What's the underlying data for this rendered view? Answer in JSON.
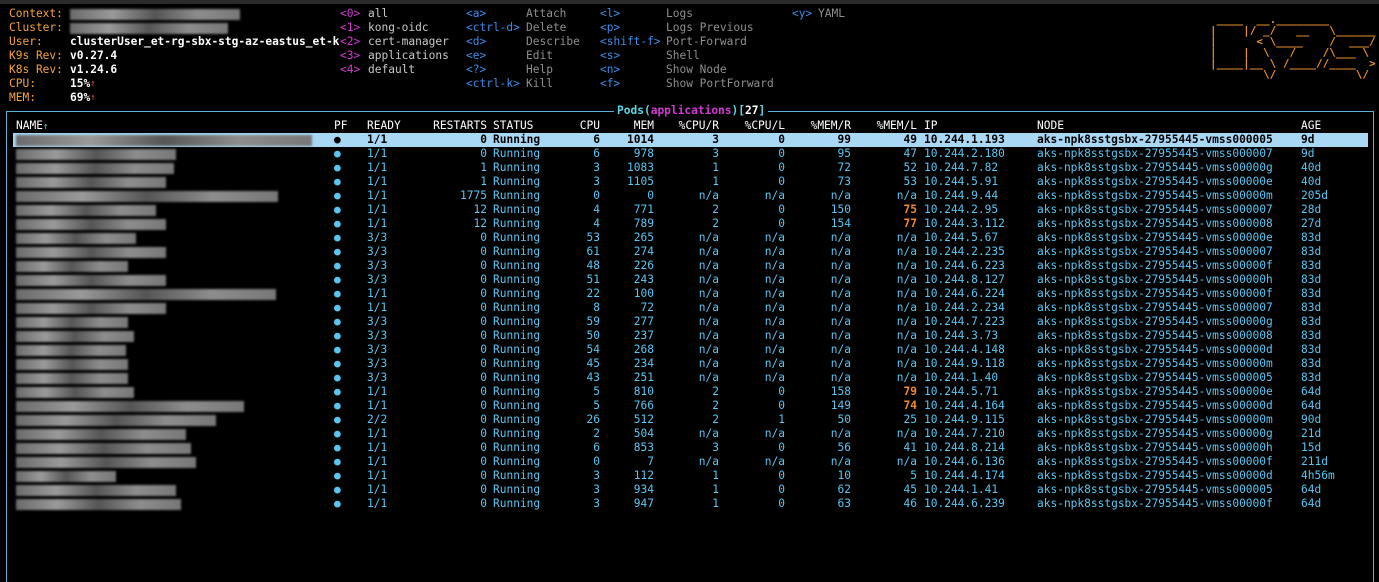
{
  "info": [
    {
      "label": "Context:",
      "value": "",
      "redacted": true
    },
    {
      "label": "Cluster:",
      "value": "",
      "redacted": true
    },
    {
      "label": "User:",
      "value": "clusterUser_et-rg-sbx-stg-az-eastus_et-k"
    },
    {
      "label": "K9s Rev:",
      "value": "v0.27.4"
    },
    {
      "label": "K8s Rev:",
      "value": "v1.24.6"
    },
    {
      "label": "CPU:",
      "value": "15%",
      "arrow": "↑"
    },
    {
      "label": "MEM:",
      "value": "69%",
      "arrow": "↑"
    }
  ],
  "namespaces": [
    {
      "key": "<0>",
      "name": "all"
    },
    {
      "key": "<1>",
      "name": "kong-oidc"
    },
    {
      "key": "<2>",
      "name": "cert-manager"
    },
    {
      "key": "<3>",
      "name": "applications"
    },
    {
      "key": "<4>",
      "name": "default"
    }
  ],
  "hotkeys_col1": [
    {
      "key": "<a>",
      "label": "Attach"
    },
    {
      "key": "<ctrl-d>",
      "label": "Delete"
    },
    {
      "key": "<d>",
      "label": "Describe"
    },
    {
      "key": "<e>",
      "label": "Edit"
    },
    {
      "key": "<?>",
      "label": "Help"
    },
    {
      "key": "<ctrl-k>",
      "label": "Kill"
    }
  ],
  "hotkeys_col2": [
    {
      "key": "<l>",
      "label": "Logs"
    },
    {
      "key": "<p>",
      "label": "Logs Previous"
    },
    {
      "key": "<shift-f>",
      "label": "Port-Forward"
    },
    {
      "key": "<s>",
      "label": "Shell"
    },
    {
      "key": "<n>",
      "label": "Show Node"
    },
    {
      "key": "<f>",
      "label": "Show PortForward"
    }
  ],
  "hotkeys_col3": [
    {
      "key": "<y>",
      "label": "YAML"
    }
  ],
  "logo": [
    " ____  __.________       ",
    "|    |/ _/   __   \\______",
    "|      < \\____    /  ___/",
    "|    |  \\   /    /\\___ \\ ",
    "|____|__ \\ /____//____  >",
    "        \\/            \\/ "
  ],
  "table_title": {
    "resource": "Pods",
    "namespace": "applications",
    "count": "27"
  },
  "columns": {
    "name": "NAME",
    "sort_arrow": "↑",
    "pf": "PF",
    "ready": "READY",
    "restarts": "RESTARTS",
    "status": "STATUS",
    "cpu": "CPU",
    "mem": "MEM",
    "cpu_r": "%CPU/R",
    "cpu_l": "%CPU/L",
    "mem_r": "%MEM/R",
    "mem_l": "%MEM/L",
    "ip": "IP",
    "node": "NODE",
    "age": "AGE"
  },
  "rows": [
    {
      "pf": "●",
      "ready": "1/1",
      "restarts": "0",
      "status": "Running",
      "cpu": "6",
      "mem": "1014",
      "cpu_r": "3",
      "cpu_l": "0",
      "mem_r": "99",
      "mem_l": "49",
      "ip": "10.244.1.193",
      "node": "aks-npk8sstgsbx-27955445-vmss000005",
      "age": "9d"
    },
    {
      "pf": "●",
      "ready": "1/1",
      "restarts": "0",
      "status": "Running",
      "cpu": "6",
      "mem": "978",
      "cpu_r": "3",
      "cpu_l": "0",
      "mem_r": "95",
      "mem_l": "47",
      "ip": "10.244.2.180",
      "node": "aks-npk8sstgsbx-27955445-vmss000007",
      "age": "9d"
    },
    {
      "pf": "●",
      "ready": "1/1",
      "restarts": "1",
      "status": "Running",
      "cpu": "3",
      "mem": "1083",
      "cpu_r": "1",
      "cpu_l": "0",
      "mem_r": "72",
      "mem_l": "52",
      "ip": "10.244.7.82",
      "node": "aks-npk8sstgsbx-27955445-vmss00000g",
      "age": "40d"
    },
    {
      "pf": "●",
      "ready": "1/1",
      "restarts": "1",
      "status": "Running",
      "cpu": "3",
      "mem": "1105",
      "cpu_r": "1",
      "cpu_l": "0",
      "mem_r": "73",
      "mem_l": "53",
      "ip": "10.244.5.91",
      "node": "aks-npk8sstgsbx-27955445-vmss00000e",
      "age": "40d"
    },
    {
      "pf": "●",
      "ready": "1/1",
      "restarts": "1775",
      "status": "Running",
      "cpu": "0",
      "mem": "0",
      "cpu_r": "n/a",
      "cpu_l": "n/a",
      "mem_r": "n/a",
      "mem_l": "n/a",
      "ip": "10.244.9.44",
      "node": "aks-npk8sstgsbx-27955445-vmss00000m",
      "age": "205d"
    },
    {
      "pf": "●",
      "ready": "1/1",
      "restarts": "12",
      "status": "Running",
      "cpu": "4",
      "mem": "771",
      "cpu_r": "2",
      "cpu_l": "0",
      "mem_r": "150",
      "mem_l": "75",
      "warn": true,
      "ip": "10.244.2.95",
      "node": "aks-npk8sstgsbx-27955445-vmss000007",
      "age": "28d"
    },
    {
      "pf": "●",
      "ready": "1/1",
      "restarts": "12",
      "status": "Running",
      "cpu": "4",
      "mem": "789",
      "cpu_r": "2",
      "cpu_l": "0",
      "mem_r": "154",
      "mem_l": "77",
      "warn": true,
      "ip": "10.244.3.112",
      "node": "aks-npk8sstgsbx-27955445-vmss000008",
      "age": "27d"
    },
    {
      "pf": "●",
      "ready": "3/3",
      "restarts": "0",
      "status": "Running",
      "cpu": "53",
      "mem": "265",
      "cpu_r": "n/a",
      "cpu_l": "n/a",
      "mem_r": "n/a",
      "mem_l": "n/a",
      "ip": "10.244.5.67",
      "node": "aks-npk8sstgsbx-27955445-vmss00000e",
      "age": "83d"
    },
    {
      "pf": "●",
      "ready": "3/3",
      "restarts": "0",
      "status": "Running",
      "cpu": "61",
      "mem": "274",
      "cpu_r": "n/a",
      "cpu_l": "n/a",
      "mem_r": "n/a",
      "mem_l": "n/a",
      "ip": "10.244.2.235",
      "node": "aks-npk8sstgsbx-27955445-vmss000007",
      "age": "83d"
    },
    {
      "pf": "●",
      "ready": "3/3",
      "restarts": "0",
      "status": "Running",
      "cpu": "48",
      "mem": "226",
      "cpu_r": "n/a",
      "cpu_l": "n/a",
      "mem_r": "n/a",
      "mem_l": "n/a",
      "ip": "10.244.6.223",
      "node": "aks-npk8sstgsbx-27955445-vmss00000f",
      "age": "83d"
    },
    {
      "pf": "●",
      "ready": "3/3",
      "restarts": "0",
      "status": "Running",
      "cpu": "51",
      "mem": "243",
      "cpu_r": "n/a",
      "cpu_l": "n/a",
      "mem_r": "n/a",
      "mem_l": "n/a",
      "ip": "10.244.8.127",
      "node": "aks-npk8sstgsbx-27955445-vmss00000h",
      "age": "83d"
    },
    {
      "pf": "●",
      "ready": "1/1",
      "restarts": "0",
      "status": "Running",
      "cpu": "22",
      "mem": "100",
      "cpu_r": "n/a",
      "cpu_l": "n/a",
      "mem_r": "n/a",
      "mem_l": "n/a",
      "ip": "10.244.6.224",
      "node": "aks-npk8sstgsbx-27955445-vmss00000f",
      "age": "83d"
    },
    {
      "pf": "●",
      "ready": "1/1",
      "restarts": "0",
      "status": "Running",
      "cpu": "8",
      "mem": "72",
      "cpu_r": "n/a",
      "cpu_l": "n/a",
      "mem_r": "n/a",
      "mem_l": "n/a",
      "ip": "10.244.2.234",
      "node": "aks-npk8sstgsbx-27955445-vmss000007",
      "age": "83d"
    },
    {
      "pf": "●",
      "ready": "3/3",
      "restarts": "0",
      "status": "Running",
      "cpu": "59",
      "mem": "277",
      "cpu_r": "n/a",
      "cpu_l": "n/a",
      "mem_r": "n/a",
      "mem_l": "n/a",
      "ip": "10.244.7.223",
      "node": "aks-npk8sstgsbx-27955445-vmss00000g",
      "age": "83d"
    },
    {
      "pf": "●",
      "ready": "3/3",
      "restarts": "0",
      "status": "Running",
      "cpu": "50",
      "mem": "237",
      "cpu_r": "n/a",
      "cpu_l": "n/a",
      "mem_r": "n/a",
      "mem_l": "n/a",
      "ip": "10.244.3.73",
      "node": "aks-npk8sstgsbx-27955445-vmss000008",
      "age": "83d"
    },
    {
      "pf": "●",
      "ready": "3/3",
      "restarts": "0",
      "status": "Running",
      "cpu": "54",
      "mem": "268",
      "cpu_r": "n/a",
      "cpu_l": "n/a",
      "mem_r": "n/a",
      "mem_l": "n/a",
      "ip": "10.244.4.148",
      "node": "aks-npk8sstgsbx-27955445-vmss00000d",
      "age": "83d"
    },
    {
      "pf": "●",
      "ready": "3/3",
      "restarts": "0",
      "status": "Running",
      "cpu": "45",
      "mem": "234",
      "cpu_r": "n/a",
      "cpu_l": "n/a",
      "mem_r": "n/a",
      "mem_l": "n/a",
      "ip": "10.244.9.118",
      "node": "aks-npk8sstgsbx-27955445-vmss00000m",
      "age": "83d"
    },
    {
      "pf": "●",
      "ready": "3/3",
      "restarts": "0",
      "status": "Running",
      "cpu": "43",
      "mem": "251",
      "cpu_r": "n/a",
      "cpu_l": "n/a",
      "mem_r": "n/a",
      "mem_l": "n/a",
      "ip": "10.244.1.40",
      "node": "aks-npk8sstgsbx-27955445-vmss000005",
      "age": "83d"
    },
    {
      "pf": "●",
      "ready": "1/1",
      "restarts": "0",
      "status": "Running",
      "cpu": "5",
      "mem": "810",
      "cpu_r": "2",
      "cpu_l": "0",
      "mem_r": "158",
      "mem_l": "79",
      "warn": true,
      "ip": "10.244.5.71",
      "node": "aks-npk8sstgsbx-27955445-vmss00000e",
      "age": "64d"
    },
    {
      "pf": "●",
      "ready": "1/1",
      "restarts": "0",
      "status": "Running",
      "cpu": "5",
      "mem": "766",
      "cpu_r": "2",
      "cpu_l": "0",
      "mem_r": "149",
      "mem_l": "74",
      "warn": true,
      "ip": "10.244.4.164",
      "node": "aks-npk8sstgsbx-27955445-vmss00000d",
      "age": "64d"
    },
    {
      "pf": "●",
      "ready": "2/2",
      "restarts": "0",
      "status": "Running",
      "cpu": "26",
      "mem": "512",
      "cpu_r": "2",
      "cpu_l": "1",
      "mem_r": "50",
      "mem_l": "25",
      "ip": "10.244.9.115",
      "node": "aks-npk8sstgsbx-27955445-vmss00000m",
      "age": "90d"
    },
    {
      "pf": "●",
      "ready": "1/1",
      "restarts": "0",
      "status": "Running",
      "cpu": "2",
      "mem": "504",
      "cpu_r": "n/a",
      "cpu_l": "n/a",
      "mem_r": "n/a",
      "mem_l": "n/a",
      "ip": "10.244.7.210",
      "node": "aks-npk8sstgsbx-27955445-vmss00000g",
      "age": "21d"
    },
    {
      "pf": "●",
      "ready": "1/1",
      "restarts": "0",
      "status": "Running",
      "cpu": "6",
      "mem": "853",
      "cpu_r": "3",
      "cpu_l": "0",
      "mem_r": "56",
      "mem_l": "41",
      "ip": "10.244.8.214",
      "node": "aks-npk8sstgsbx-27955445-vmss00000h",
      "age": "15d"
    },
    {
      "pf": "●",
      "ready": "1/1",
      "restarts": "0",
      "status": "Running",
      "cpu": "0",
      "mem": "7",
      "cpu_r": "n/a",
      "cpu_l": "n/a",
      "mem_r": "n/a",
      "mem_l": "n/a",
      "ip": "10.244.6.136",
      "node": "aks-npk8sstgsbx-27955445-vmss00000f",
      "age": "211d"
    },
    {
      "pf": "●",
      "ready": "1/1",
      "restarts": "0",
      "status": "Running",
      "cpu": "3",
      "mem": "112",
      "cpu_r": "1",
      "cpu_l": "0",
      "mem_r": "10",
      "mem_l": "5",
      "ip": "10.244.4.174",
      "node": "aks-npk8sstgsbx-27955445-vmss00000d",
      "age": "4h56m"
    },
    {
      "pf": "●",
      "ready": "1/1",
      "restarts": "0",
      "status": "Running",
      "cpu": "3",
      "mem": "934",
      "cpu_r": "1",
      "cpu_l": "0",
      "mem_r": "62",
      "mem_l": "45",
      "ip": "10.244.1.41",
      "node": "aks-npk8sstgsbx-27955445-vmss000005",
      "age": "64d"
    },
    {
      "pf": "●",
      "ready": "1/1",
      "restarts": "0",
      "status": "Running",
      "cpu": "3",
      "mem": "947",
      "cpu_r": "1",
      "cpu_l": "0",
      "mem_r": "63",
      "mem_l": "46",
      "ip": "10.244.6.239",
      "node": "aks-npk8sstgsbx-27955445-vmss00000f",
      "age": "64d"
    }
  ],
  "colors": {
    "accent": "#5ad6e6",
    "label": "#f4a33b",
    "key": "#3b8eea",
    "namespace_key": "#d438d4",
    "row_text": "#59c6f2",
    "selected_bg": "#a9d8f5",
    "warning": "#f08a2c",
    "border": "#5db2d8"
  }
}
